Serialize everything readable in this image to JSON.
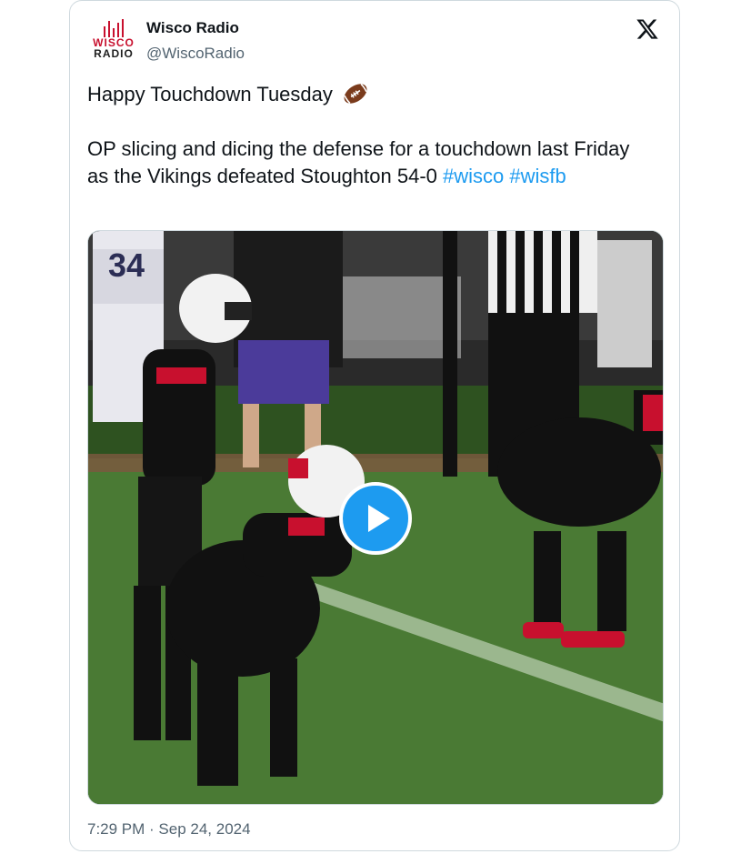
{
  "tweet": {
    "display_name": "Wisco Radio",
    "handle": "@WiscoRadio",
    "logo_line1": "WISCO",
    "logo_line2": "RADIO",
    "line1": "Happy Touchdown Tuesday",
    "line2_text": "OP slicing and dicing the defense for a touchdown last Friday as the Vikings defeated Stoughton 54-0",
    "hashtags": [
      "#wisco",
      "#wisfb"
    ],
    "timestamp": "7:29 PM · Sep 24, 2024",
    "jersey_number": "34"
  },
  "icons": {
    "platform": "x-logo-icon",
    "emoji": "football-emoji",
    "media_action": "play-icon"
  },
  "colors": {
    "hashtag": "#1d9bf0",
    "play_button": "#1d9bf0",
    "logo_red": "#c8102e",
    "secondary_text": "#536471"
  }
}
